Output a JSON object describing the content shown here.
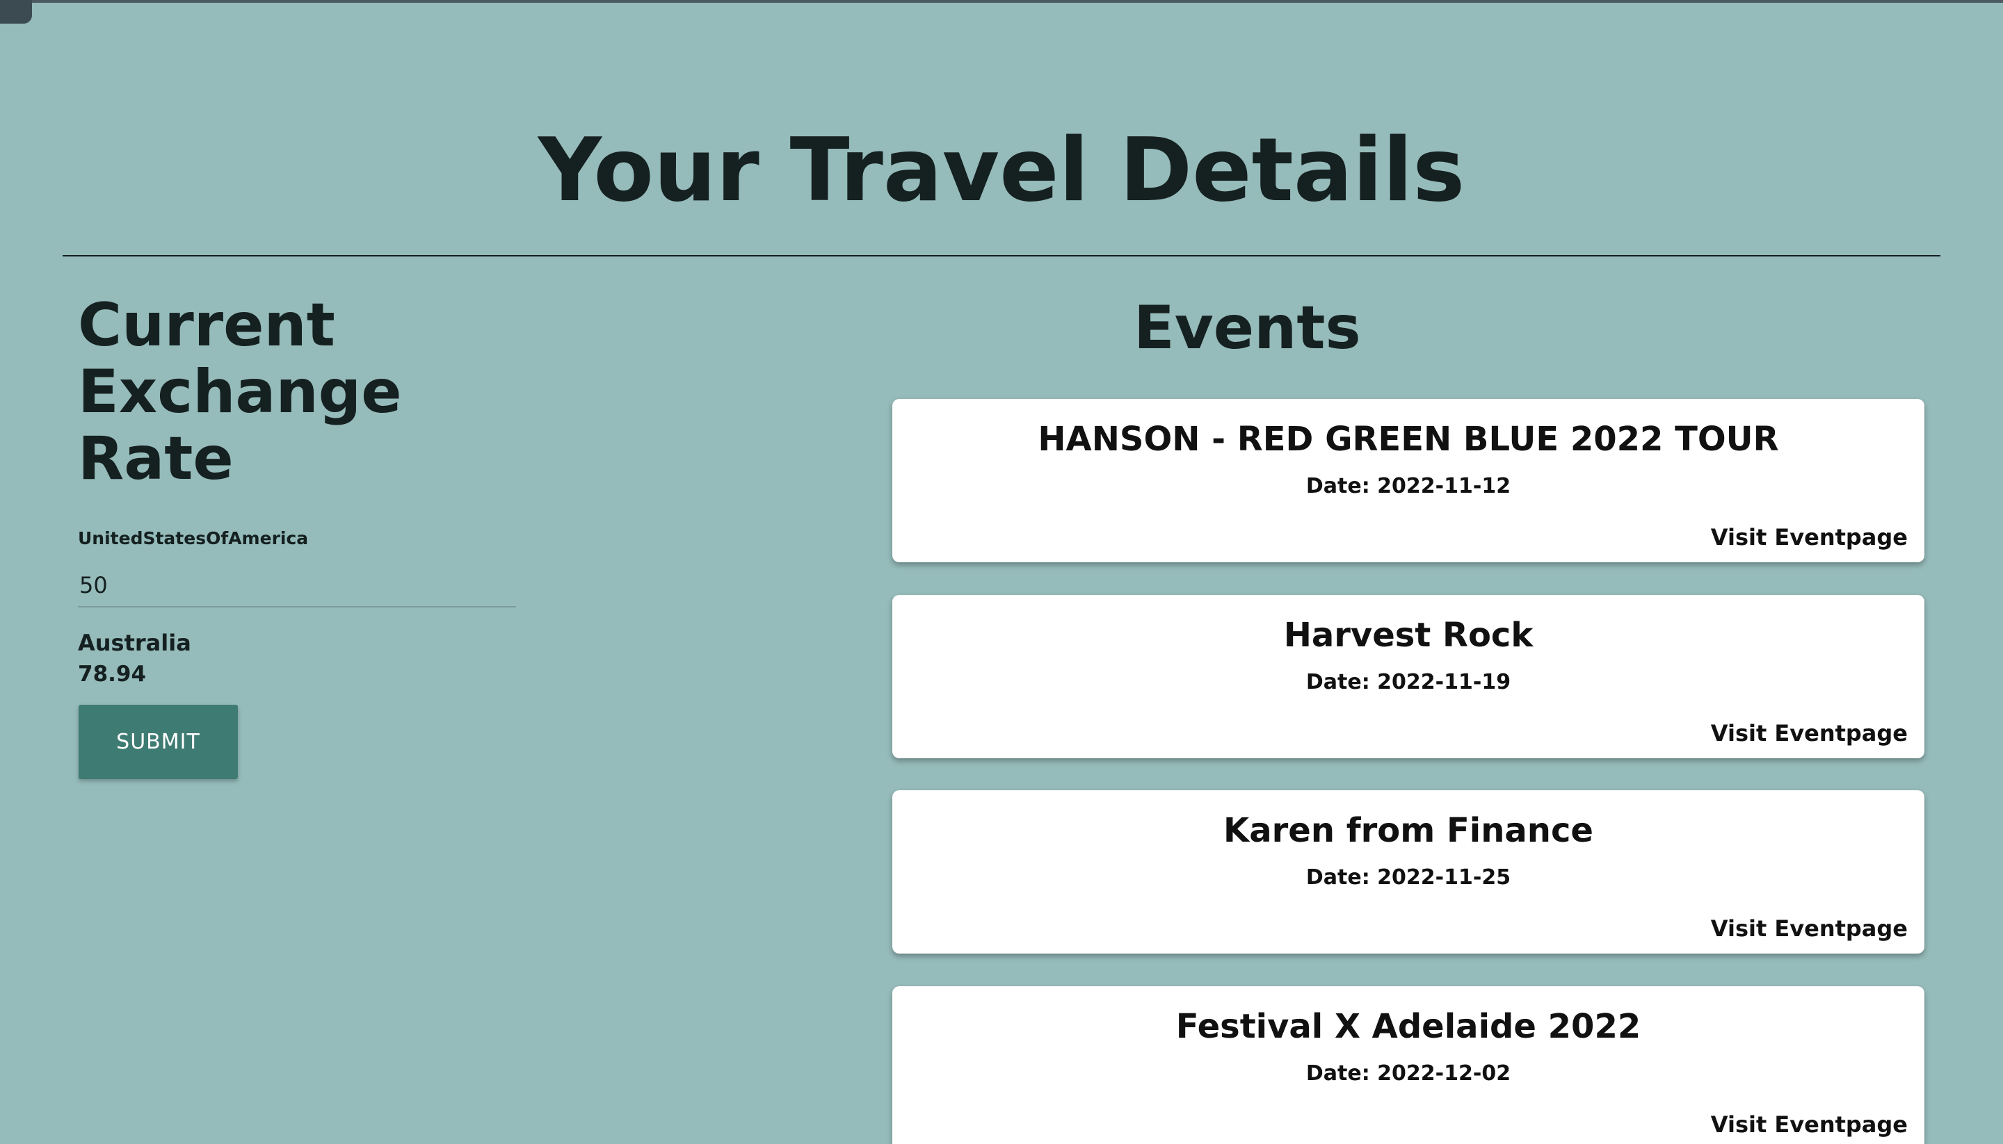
{
  "header": {
    "title": "Your Travel Details"
  },
  "exchange": {
    "heading": "Current Exchange Rate",
    "from_country": "UnitedStatesOfAmerica",
    "amount": "50",
    "to_country": "Australia",
    "converted": "78.94",
    "submit_label": "SUBMIT"
  },
  "events": {
    "heading": "Events",
    "items": [
      {
        "name": "HANSON - RED GREEN BLUE 2022 TOUR",
        "date": "Date: 2022-11-12",
        "link_label": "Visit Eventpage"
      },
      {
        "name": "Harvest Rock",
        "date": "Date: 2022-11-19",
        "link_label": "Visit Eventpage"
      },
      {
        "name": "Karen from Finance",
        "date": "Date: 2022-11-25",
        "link_label": "Visit Eventpage"
      },
      {
        "name": "Festival X Adelaide 2022",
        "date": "Date: 2022-12-02",
        "link_label": "Visit Eventpage"
      }
    ]
  },
  "colors": {
    "background": "#95bbba",
    "button": "#3e7b73",
    "card": "#ffffff",
    "text": "#152020"
  }
}
